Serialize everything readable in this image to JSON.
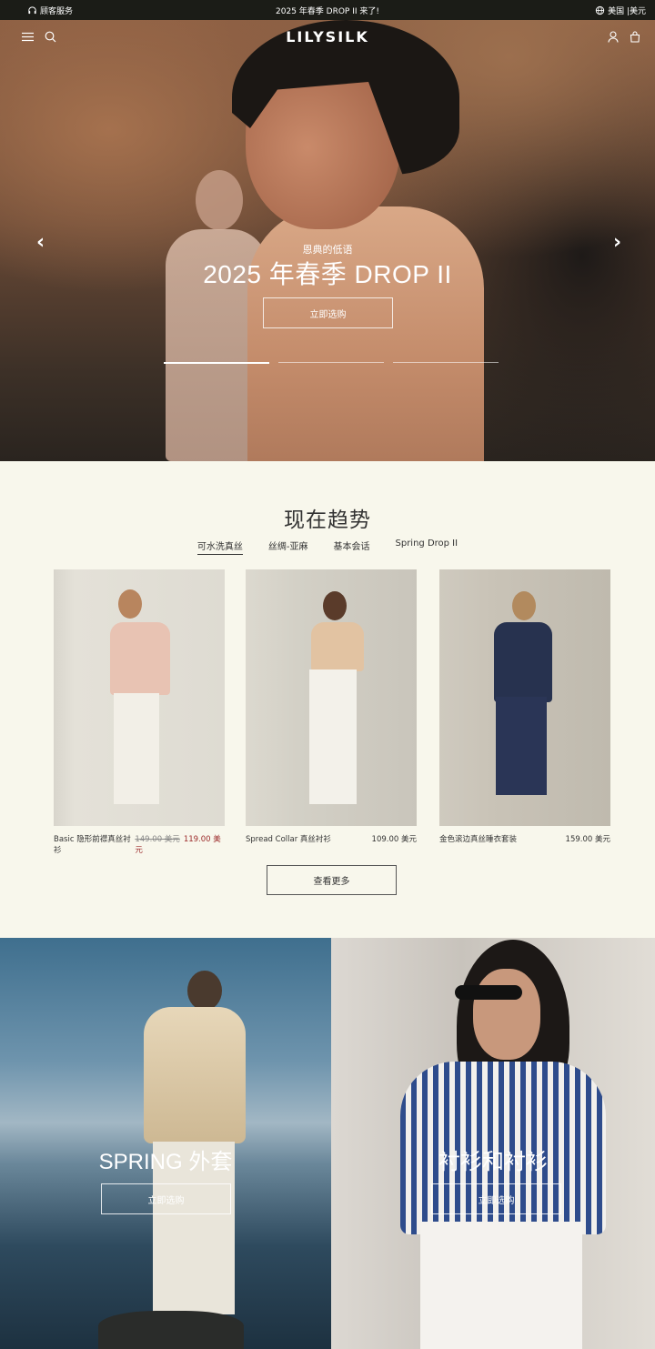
{
  "announcement": {
    "customer_service": "顾客服务",
    "message": "2025 年春季 DROP II 来了!",
    "region": "美国 |美元"
  },
  "nav": {
    "logo": "LILYSILK"
  },
  "hero": {
    "subtitle": "恩典的低语",
    "title": "2025 年春季 DROP II",
    "cta": "立即选购",
    "slides_total": 3,
    "active_slide": 1
  },
  "trending": {
    "title": "现在趋势",
    "tabs": [
      "可水洗真丝",
      "丝绸-亚麻",
      "基本会话",
      "Spring Drop II"
    ],
    "active_tab": 0,
    "products": [
      {
        "name": "Basic 隐形前襟真丝衬衫",
        "old_price": "149.00 美元",
        "price": "119.00 美元"
      },
      {
        "name": "Spread Collar 真丝衬衫",
        "price": "109.00 美元"
      },
      {
        "name": "金色滚边真丝睡衣套装",
        "price": "159.00 美元"
      }
    ],
    "more": "查看更多"
  },
  "banners": [
    {
      "title": "SPRING 外套",
      "cta": "立即选购"
    },
    {
      "title": "衬衫和衬衫",
      "cta": "立即选购"
    }
  ],
  "colors": {
    "announcement_bg": "#1b1c17",
    "page_bg": "#f8f7ec",
    "sale_price": "#9b2a2a"
  }
}
